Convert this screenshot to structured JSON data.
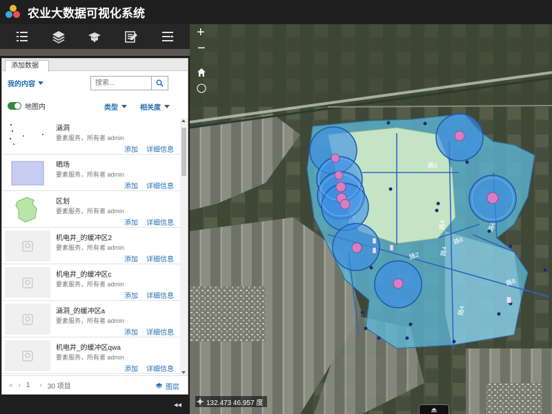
{
  "app": {
    "title": "农业大数据可视化系统"
  },
  "toolbar": {
    "buttons": [
      {
        "icon": "list-icon"
      },
      {
        "icon": "layers-icon"
      },
      {
        "icon": "basemap-icon"
      },
      {
        "icon": "edit-icon"
      },
      {
        "icon": "menu-icon"
      }
    ]
  },
  "panel": {
    "tab_label": "添加数据",
    "my_content_label": "我的内容",
    "search_placeholder": "搜索...",
    "in_map_label": "地图内",
    "sort_type_label": "类型",
    "sort_relevance_label": "相关度",
    "items": [
      {
        "title": "涵洞",
        "subtitle": "要素服务，所有者 admin",
        "add": "添加",
        "detail": "详细信息",
        "thumb": "points"
      },
      {
        "title": "晒场",
        "subtitle": "要素服务，所有者 admin",
        "add": "添加",
        "detail": "详细信息",
        "thumb": "square"
      },
      {
        "title": "区划",
        "subtitle": "要素服务，所有者 admin",
        "add": "添加",
        "detail": "详细信息",
        "thumb": "polygon"
      },
      {
        "title": "机电井_的缓冲区2",
        "subtitle": "要素服务，所有者 admin",
        "add": "添加",
        "detail": "详细信息",
        "thumb": "placeholder"
      },
      {
        "title": "机电井_的缓冲区c",
        "subtitle": "要素服务，所有者 admin",
        "add": "添加",
        "detail": "详细信息",
        "thumb": "placeholder"
      },
      {
        "title": "涵洞_的缓冲区a",
        "subtitle": "要素服务，所有者 admin",
        "add": "添加",
        "detail": "详细信息",
        "thumb": "placeholder"
      },
      {
        "title": "机电井_的缓冲区qwa",
        "subtitle": "要素服务，所有者 admin",
        "add": "添加",
        "detail": "详细信息",
        "thumb": "placeholder"
      }
    ],
    "pager": {
      "first": "«",
      "prev": "‹",
      "page": "1",
      "next": "›",
      "count": "30 项目",
      "layers_label": "图层"
    },
    "collapse": "◂◂"
  },
  "map": {
    "zoom_in": "+",
    "zoom_out": "−",
    "coordinates": "132.473 46.957 度",
    "road_labels": [
      "路5",
      "路4",
      "路4",
      "路6",
      "路2",
      "路8",
      "路6",
      "路4",
      "路1"
    ],
    "colors": {
      "zone_fill": "#5cb8d6",
      "field_fill": "#d8f0c8",
      "buffer_fill": "#3c8ee6",
      "well_dot": "#d77fc4",
      "road": "#2f66c2"
    }
  }
}
